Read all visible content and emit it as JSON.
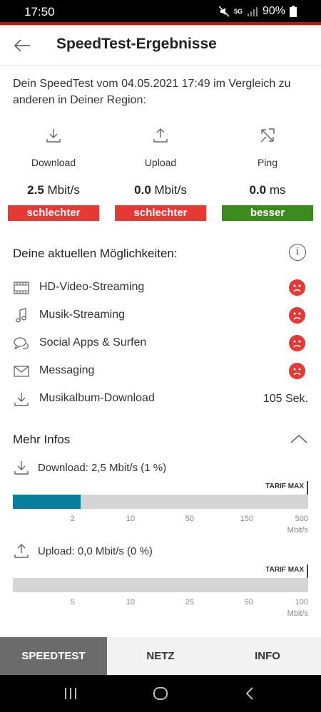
{
  "status": {
    "time": "17:50",
    "battery": "90%",
    "network": "5G"
  },
  "header": {
    "title": "SpeedTest-Ergebnisse"
  },
  "intro": "Dein SpeedTest vom 04.05.2021 17:49 im Vergleich zu anderen in Deiner Region:",
  "metrics": [
    {
      "label": "Download",
      "value": "2.5",
      "unit": "Mbit/s",
      "badge": "schlechter",
      "badge_color": "#e53935",
      "icon": "download-icon"
    },
    {
      "label": "Upload",
      "value": "0.0",
      "unit": "Mbit/s",
      "badge": "schlechter",
      "badge_color": "#e53935",
      "icon": "upload-icon"
    },
    {
      "label": "Ping",
      "value": "0.0",
      "unit": "ms",
      "badge": "besser",
      "badge_color": "#3d8b1f",
      "icon": "ping-icon"
    }
  ],
  "options": {
    "title": "Deine aktuellen Möglichkeiten:",
    "items": [
      {
        "label": "HD-Video-Streaming",
        "icon": "film-icon",
        "status": "sad"
      },
      {
        "label": "Musik-Streaming",
        "icon": "music-note-icon",
        "status": "sad"
      },
      {
        "label": "Social Apps & Surfen",
        "icon": "chat-bubbles-icon",
        "status": "sad"
      },
      {
        "label": "Messaging",
        "icon": "envelope-icon",
        "status": "sad"
      },
      {
        "label": "Musikalbum-Download",
        "icon": "download-icon",
        "value": "105 Sek."
      }
    ]
  },
  "more": {
    "title": "Mehr Infos",
    "download": {
      "label": "Download: 2,5 Mbit/s (1 %)",
      "tarif": "TARIF MAX",
      "fill_fraction": 0.23,
      "ticks": [
        "2",
        "10",
        "50",
        "150",
        "500"
      ],
      "unit": "Mbit/s"
    },
    "upload": {
      "label": "Upload: 0,0 Mbit/s (0 %)",
      "tarif": "TARIF MAX",
      "fill_fraction": 0,
      "ticks": [
        "5",
        "10",
        "25",
        "50",
        "100"
      ],
      "unit": "Mbit/s"
    }
  },
  "tabs": [
    {
      "label": "SPEEDTEST",
      "active": true
    },
    {
      "label": "NETZ",
      "active": false
    },
    {
      "label": "INFO",
      "active": false
    }
  ]
}
